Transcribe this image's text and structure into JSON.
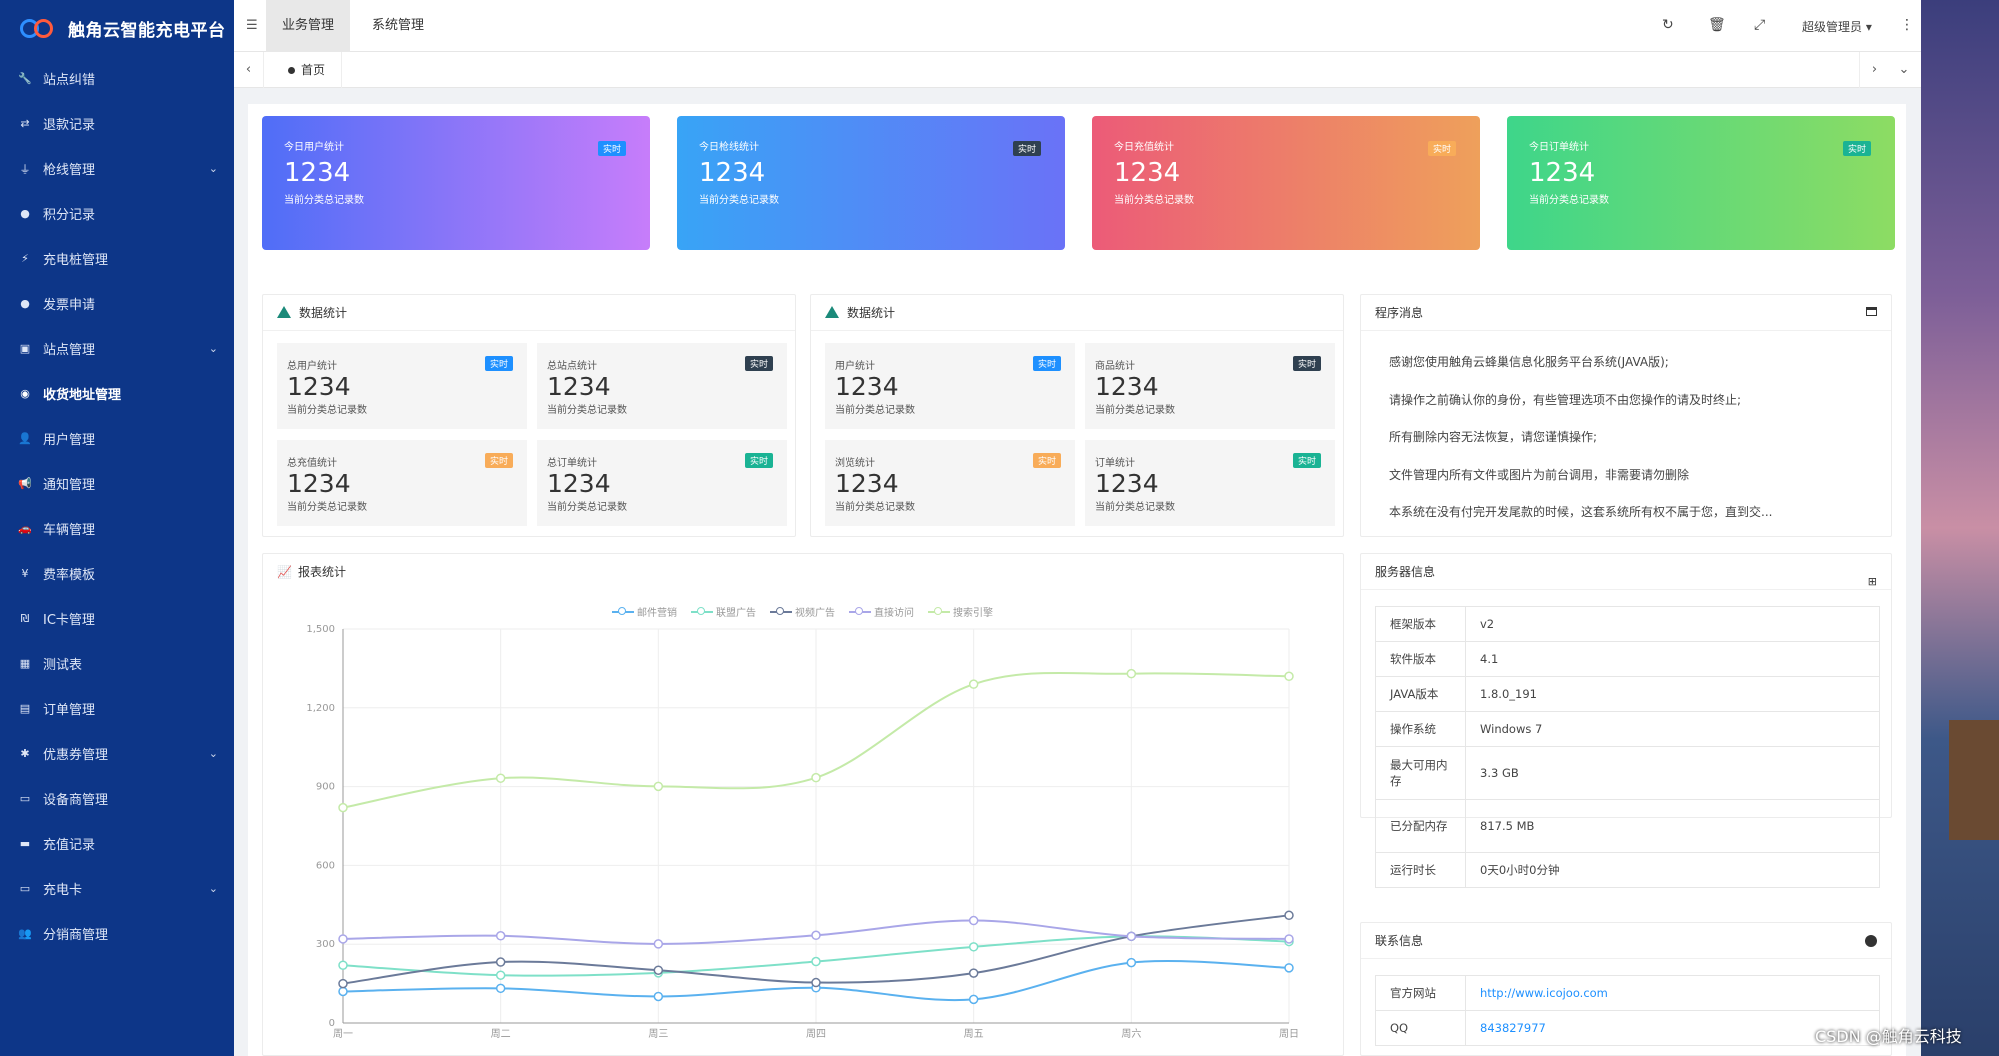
{
  "app": {
    "title": "触角云智能充电平台",
    "watermark": "CSDN @触角云科技"
  },
  "sidebar": {
    "items": [
      {
        "label": "站点纠错",
        "icon": "wrench-icon"
      },
      {
        "label": "退款记录",
        "icon": "arrows-icon"
      },
      {
        "label": "枪线管理",
        "icon": "plug-icon",
        "expand": true
      },
      {
        "label": "积分记录",
        "icon": "coin-icon"
      },
      {
        "label": "充电桩管理",
        "icon": "charger-icon"
      },
      {
        "label": "发票申请",
        "icon": "invoice-icon"
      },
      {
        "label": "站点管理",
        "icon": "station-icon",
        "expand": true
      },
      {
        "label": "收货地址管理",
        "icon": "location-icon",
        "active": true
      },
      {
        "label": "用户管理",
        "icon": "user-icon"
      },
      {
        "label": "通知管理",
        "icon": "megaphone-icon"
      },
      {
        "label": "车辆管理",
        "icon": "car-icon"
      },
      {
        "label": "费率模板",
        "icon": "yen-icon"
      },
      {
        "label": "IC卡管理",
        "icon": "card-icon"
      },
      {
        "label": "测试表",
        "icon": "table-icon"
      },
      {
        "label": "订单管理",
        "icon": "order-icon"
      },
      {
        "label": "优惠券管理",
        "icon": "coupon-icon",
        "expand": true
      },
      {
        "label": "设备商管理",
        "icon": "device-icon"
      },
      {
        "label": "充值记录",
        "icon": "visa-icon"
      },
      {
        "label": "充电卡",
        "icon": "credit-card-icon",
        "expand": true
      },
      {
        "label": "分销商管理",
        "icon": "users-icon"
      }
    ]
  },
  "topbar": {
    "tab_business": "业务管理",
    "tab_system": "系统管理",
    "user": "超级管理员 ▾"
  },
  "tabs": {
    "home": "首页"
  },
  "cards": [
    {
      "title": "今日用户统计",
      "value": "1234",
      "sub": "当前分类总记录数",
      "badge": "实时",
      "badge_color": "#1e90ff"
    },
    {
      "title": "今日枪线统计",
      "value": "1234",
      "sub": "当前分类总记录数",
      "badge": "实时",
      "badge_color": "#2f4050"
    },
    {
      "title": "今日充值统计",
      "value": "1234",
      "sub": "当前分类总记录数",
      "badge": "实时",
      "badge_color": "#f8ac59"
    },
    {
      "title": "今日订单统计",
      "value": "1234",
      "sub": "当前分类总记录数",
      "badge": "实时",
      "badge_color": "#1ab394"
    }
  ],
  "stats_left": {
    "title": "数据统计",
    "items": [
      {
        "title": "总用户统计",
        "value": "1234",
        "sub": "当前分类总记录数",
        "badge": "实时",
        "badge_color": "#1e90ff"
      },
      {
        "title": "总站点统计",
        "value": "1234",
        "sub": "当前分类总记录数",
        "badge": "实时",
        "badge_color": "#2f4050"
      },
      {
        "title": "总充值统计",
        "value": "1234",
        "sub": "当前分类总记录数",
        "badge": "实时",
        "badge_color": "#f8ac59"
      },
      {
        "title": "总订单统计",
        "value": "1234",
        "sub": "当前分类总记录数",
        "badge": "实时",
        "badge_color": "#1ab394"
      }
    ]
  },
  "stats_right": {
    "title": "数据统计",
    "items": [
      {
        "title": "用户统计",
        "value": "1234",
        "sub": "当前分类总记录数",
        "badge": "实时",
        "badge_color": "#1e90ff"
      },
      {
        "title": "商品统计",
        "value": "1234",
        "sub": "当前分类总记录数",
        "badge": "实时",
        "badge_color": "#2f4050"
      },
      {
        "title": "浏览统计",
        "value": "1234",
        "sub": "当前分类总记录数",
        "badge": "实时",
        "badge_color": "#f8ac59"
      },
      {
        "title": "订单统计",
        "value": "1234",
        "sub": "当前分类总记录数",
        "badge": "实时",
        "badge_color": "#1ab394"
      }
    ]
  },
  "messages": {
    "title": "程序消息",
    "lines": [
      "感谢您使用触角云蜂巢信息化服务平台系统(JAVA版);",
      "请操作之前确认你的身份，有些管理选项不由您操作的请及时终止;",
      "所有删除内容无法恢复，请您谨慎操作;",
      "文件管理内所有文件或图片为前台调用，非需要请勿删除",
      "本系统在没有付完开发尾款的时候，这套系统所有权不属于您，直到交..."
    ]
  },
  "server": {
    "title": "服务器信息",
    "rows": [
      {
        "k": "框架版本",
        "v": "v2"
      },
      {
        "k": "软件版本",
        "v": "4.1"
      },
      {
        "k": "JAVA版本",
        "v": "1.8.0_191"
      },
      {
        "k": "操作系统",
        "v": "Windows 7"
      },
      {
        "k": "最大可用内存",
        "v": "3.3 GB"
      },
      {
        "k": "已分配内存",
        "v": "817.5 MB"
      },
      {
        "k": "运行时长",
        "v": "0天0小时0分钟"
      }
    ]
  },
  "contact": {
    "title": "联系信息",
    "rows": [
      {
        "k": "官方网站",
        "v": "http://www.icojoo.com"
      },
      {
        "k": "QQ",
        "v": "843827977"
      }
    ]
  },
  "chart_panel": {
    "title": "报表统计"
  },
  "chart_data": {
    "type": "line",
    "categories": [
      "周一",
      "周二",
      "周三",
      "周四",
      "周五",
      "周六",
      "周日"
    ],
    "ylim": [
      0,
      1500
    ],
    "yticks": [
      0,
      300,
      600,
      900,
      1200,
      1500
    ],
    "series": [
      {
        "name": "邮件营销",
        "color": "#5ab1ef",
        "values": [
          120,
          132,
          101,
          134,
          90,
          230,
          210
        ]
      },
      {
        "name": "联盟广告",
        "color": "#7ee0c8",
        "values": [
          220,
          182,
          191,
          234,
          290,
          330,
          310
        ]
      },
      {
        "name": "视频广告",
        "color": "#6b7a99",
        "values": [
          150,
          232,
          201,
          154,
          190,
          330,
          410
        ]
      },
      {
        "name": "直接访问",
        "color": "#a9a6e8",
        "values": [
          320,
          332,
          301,
          334,
          390,
          330,
          320
        ]
      },
      {
        "name": "搜索引擎",
        "color": "#c4eaa8",
        "values": [
          820,
          932,
          901,
          934,
          1290,
          1330,
          1320
        ]
      }
    ]
  }
}
